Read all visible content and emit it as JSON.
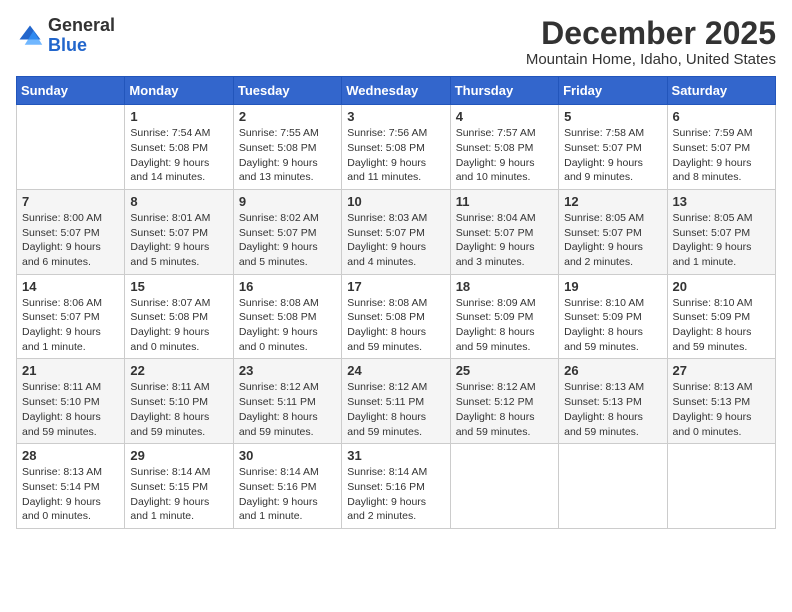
{
  "logo": {
    "general": "General",
    "blue": "Blue"
  },
  "header": {
    "month": "December 2025",
    "location": "Mountain Home, Idaho, United States"
  },
  "weekdays": [
    "Sunday",
    "Monday",
    "Tuesday",
    "Wednesday",
    "Thursday",
    "Friday",
    "Saturday"
  ],
  "weeks": [
    [
      {
        "day": "",
        "sunrise": "",
        "sunset": "",
        "daylight": ""
      },
      {
        "day": "1",
        "sunrise": "Sunrise: 7:54 AM",
        "sunset": "Sunset: 5:08 PM",
        "daylight": "Daylight: 9 hours and 14 minutes."
      },
      {
        "day": "2",
        "sunrise": "Sunrise: 7:55 AM",
        "sunset": "Sunset: 5:08 PM",
        "daylight": "Daylight: 9 hours and 13 minutes."
      },
      {
        "day": "3",
        "sunrise": "Sunrise: 7:56 AM",
        "sunset": "Sunset: 5:08 PM",
        "daylight": "Daylight: 9 hours and 11 minutes."
      },
      {
        "day": "4",
        "sunrise": "Sunrise: 7:57 AM",
        "sunset": "Sunset: 5:08 PM",
        "daylight": "Daylight: 9 hours and 10 minutes."
      },
      {
        "day": "5",
        "sunrise": "Sunrise: 7:58 AM",
        "sunset": "Sunset: 5:07 PM",
        "daylight": "Daylight: 9 hours and 9 minutes."
      },
      {
        "day": "6",
        "sunrise": "Sunrise: 7:59 AM",
        "sunset": "Sunset: 5:07 PM",
        "daylight": "Daylight: 9 hours and 8 minutes."
      }
    ],
    [
      {
        "day": "7",
        "sunrise": "Sunrise: 8:00 AM",
        "sunset": "Sunset: 5:07 PM",
        "daylight": "Daylight: 9 hours and 6 minutes."
      },
      {
        "day": "8",
        "sunrise": "Sunrise: 8:01 AM",
        "sunset": "Sunset: 5:07 PM",
        "daylight": "Daylight: 9 hours and 5 minutes."
      },
      {
        "day": "9",
        "sunrise": "Sunrise: 8:02 AM",
        "sunset": "Sunset: 5:07 PM",
        "daylight": "Daylight: 9 hours and 5 minutes."
      },
      {
        "day": "10",
        "sunrise": "Sunrise: 8:03 AM",
        "sunset": "Sunset: 5:07 PM",
        "daylight": "Daylight: 9 hours and 4 minutes."
      },
      {
        "day": "11",
        "sunrise": "Sunrise: 8:04 AM",
        "sunset": "Sunset: 5:07 PM",
        "daylight": "Daylight: 9 hours and 3 minutes."
      },
      {
        "day": "12",
        "sunrise": "Sunrise: 8:05 AM",
        "sunset": "Sunset: 5:07 PM",
        "daylight": "Daylight: 9 hours and 2 minutes."
      },
      {
        "day": "13",
        "sunrise": "Sunrise: 8:05 AM",
        "sunset": "Sunset: 5:07 PM",
        "daylight": "Daylight: 9 hours and 1 minute."
      }
    ],
    [
      {
        "day": "14",
        "sunrise": "Sunrise: 8:06 AM",
        "sunset": "Sunset: 5:07 PM",
        "daylight": "Daylight: 9 hours and 1 minute."
      },
      {
        "day": "15",
        "sunrise": "Sunrise: 8:07 AM",
        "sunset": "Sunset: 5:08 PM",
        "daylight": "Daylight: 9 hours and 0 minutes."
      },
      {
        "day": "16",
        "sunrise": "Sunrise: 8:08 AM",
        "sunset": "Sunset: 5:08 PM",
        "daylight": "Daylight: 9 hours and 0 minutes."
      },
      {
        "day": "17",
        "sunrise": "Sunrise: 8:08 AM",
        "sunset": "Sunset: 5:08 PM",
        "daylight": "Daylight: 8 hours and 59 minutes."
      },
      {
        "day": "18",
        "sunrise": "Sunrise: 8:09 AM",
        "sunset": "Sunset: 5:09 PM",
        "daylight": "Daylight: 8 hours and 59 minutes."
      },
      {
        "day": "19",
        "sunrise": "Sunrise: 8:10 AM",
        "sunset": "Sunset: 5:09 PM",
        "daylight": "Daylight: 8 hours and 59 minutes."
      },
      {
        "day": "20",
        "sunrise": "Sunrise: 8:10 AM",
        "sunset": "Sunset: 5:09 PM",
        "daylight": "Daylight: 8 hours and 59 minutes."
      }
    ],
    [
      {
        "day": "21",
        "sunrise": "Sunrise: 8:11 AM",
        "sunset": "Sunset: 5:10 PM",
        "daylight": "Daylight: 8 hours and 59 minutes."
      },
      {
        "day": "22",
        "sunrise": "Sunrise: 8:11 AM",
        "sunset": "Sunset: 5:10 PM",
        "daylight": "Daylight: 8 hours and 59 minutes."
      },
      {
        "day": "23",
        "sunrise": "Sunrise: 8:12 AM",
        "sunset": "Sunset: 5:11 PM",
        "daylight": "Daylight: 8 hours and 59 minutes."
      },
      {
        "day": "24",
        "sunrise": "Sunrise: 8:12 AM",
        "sunset": "Sunset: 5:11 PM",
        "daylight": "Daylight: 8 hours and 59 minutes."
      },
      {
        "day": "25",
        "sunrise": "Sunrise: 8:12 AM",
        "sunset": "Sunset: 5:12 PM",
        "daylight": "Daylight: 8 hours and 59 minutes."
      },
      {
        "day": "26",
        "sunrise": "Sunrise: 8:13 AM",
        "sunset": "Sunset: 5:13 PM",
        "daylight": "Daylight: 8 hours and 59 minutes."
      },
      {
        "day": "27",
        "sunrise": "Sunrise: 8:13 AM",
        "sunset": "Sunset: 5:13 PM",
        "daylight": "Daylight: 9 hours and 0 minutes."
      }
    ],
    [
      {
        "day": "28",
        "sunrise": "Sunrise: 8:13 AM",
        "sunset": "Sunset: 5:14 PM",
        "daylight": "Daylight: 9 hours and 0 minutes."
      },
      {
        "day": "29",
        "sunrise": "Sunrise: 8:14 AM",
        "sunset": "Sunset: 5:15 PM",
        "daylight": "Daylight: 9 hours and 1 minute."
      },
      {
        "day": "30",
        "sunrise": "Sunrise: 8:14 AM",
        "sunset": "Sunset: 5:16 PM",
        "daylight": "Daylight: 9 hours and 1 minute."
      },
      {
        "day": "31",
        "sunrise": "Sunrise: 8:14 AM",
        "sunset": "Sunset: 5:16 PM",
        "daylight": "Daylight: 9 hours and 2 minutes."
      },
      {
        "day": "",
        "sunrise": "",
        "sunset": "",
        "daylight": ""
      },
      {
        "day": "",
        "sunrise": "",
        "sunset": "",
        "daylight": ""
      },
      {
        "day": "",
        "sunrise": "",
        "sunset": "",
        "daylight": ""
      }
    ]
  ]
}
